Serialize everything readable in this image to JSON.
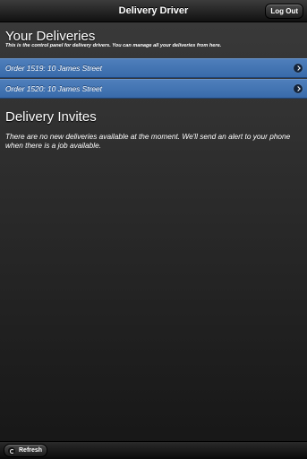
{
  "header": {
    "title": "Delivery Driver",
    "logout_label": "Log Out"
  },
  "deliveries": {
    "title": "Your Deliveries",
    "description": "This is the control panel for delivery drivers. You can manage all your deliveries from here.",
    "orders": [
      {
        "label": "Order 1519: 10 James Street",
        "icon": "chevron-right-icon"
      },
      {
        "label": "Order 1520: 10 James Street",
        "icon": "chevron-right-icon"
      }
    ]
  },
  "invites": {
    "title": "Delivery Invites",
    "message": "There are no new deliveries available at the moment. We'll send an alert to your phone when there is a job available."
  },
  "footer": {
    "refresh_label": "Refresh",
    "refresh_icon": "refresh-icon"
  },
  "colors": {
    "list_item": "#3d6eae",
    "background": "#2b2b2b"
  }
}
